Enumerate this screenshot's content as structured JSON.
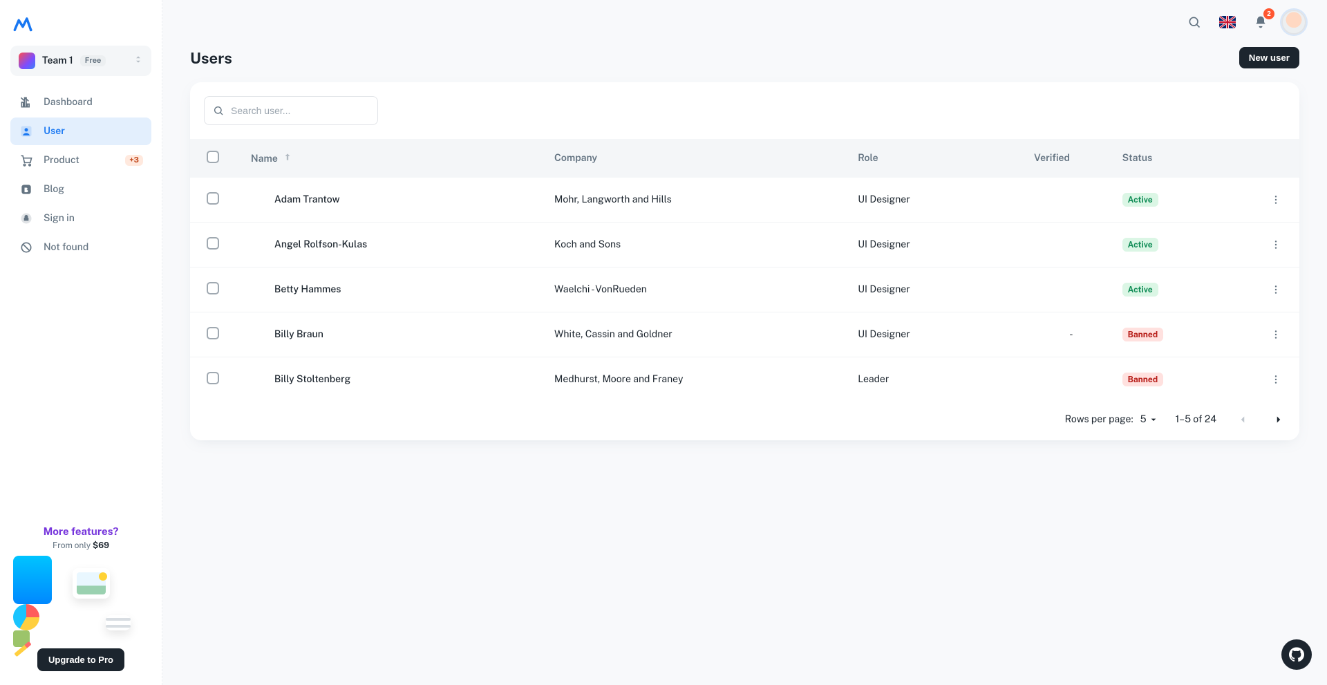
{
  "sidebar": {
    "team": {
      "name": "Team 1",
      "plan": "Free"
    },
    "items": [
      {
        "label": "Dashboard"
      },
      {
        "label": "User"
      },
      {
        "label": "Product",
        "badge": "+3"
      },
      {
        "label": "Blog"
      },
      {
        "label": "Sign in"
      },
      {
        "label": "Not found"
      }
    ],
    "promo": {
      "title": "More features?",
      "sub_prefix": "From only ",
      "sub_price": "$69",
      "cta": "Upgrade to Pro"
    }
  },
  "topbar": {
    "notifications": "2"
  },
  "page": {
    "title": "Users",
    "new_button": "New user",
    "search_placeholder": "Search user..."
  },
  "table": {
    "columns": {
      "name": "Name",
      "company": "Company",
      "role": "Role",
      "verified": "Verified",
      "status": "Status"
    },
    "status_labels": {
      "active": "Active",
      "banned": "Banned"
    },
    "rows": [
      {
        "name": "Adam Trantow",
        "company": "Mohr, Langworth and Hills",
        "role": "UI Designer",
        "verified": "",
        "status": "active"
      },
      {
        "name": "Angel Rolfson-Kulas",
        "company": "Koch and Sons",
        "role": "UI Designer",
        "verified": "",
        "status": "active"
      },
      {
        "name": "Betty Hammes",
        "company": "Waelchi - VonRueden",
        "role": "UI Designer",
        "verified": "",
        "status": "active"
      },
      {
        "name": "Billy Braun",
        "company": "White, Cassin and Goldner",
        "role": "UI Designer",
        "verified": "-",
        "status": "banned"
      },
      {
        "name": "Billy Stoltenberg",
        "company": "Medhurst, Moore and Franey",
        "role": "Leader",
        "verified": "",
        "status": "banned"
      }
    ],
    "footer": {
      "rows_per_page_label": "Rows per page:",
      "rows_per_page_value": "5",
      "range": "1–5 of 24"
    }
  }
}
